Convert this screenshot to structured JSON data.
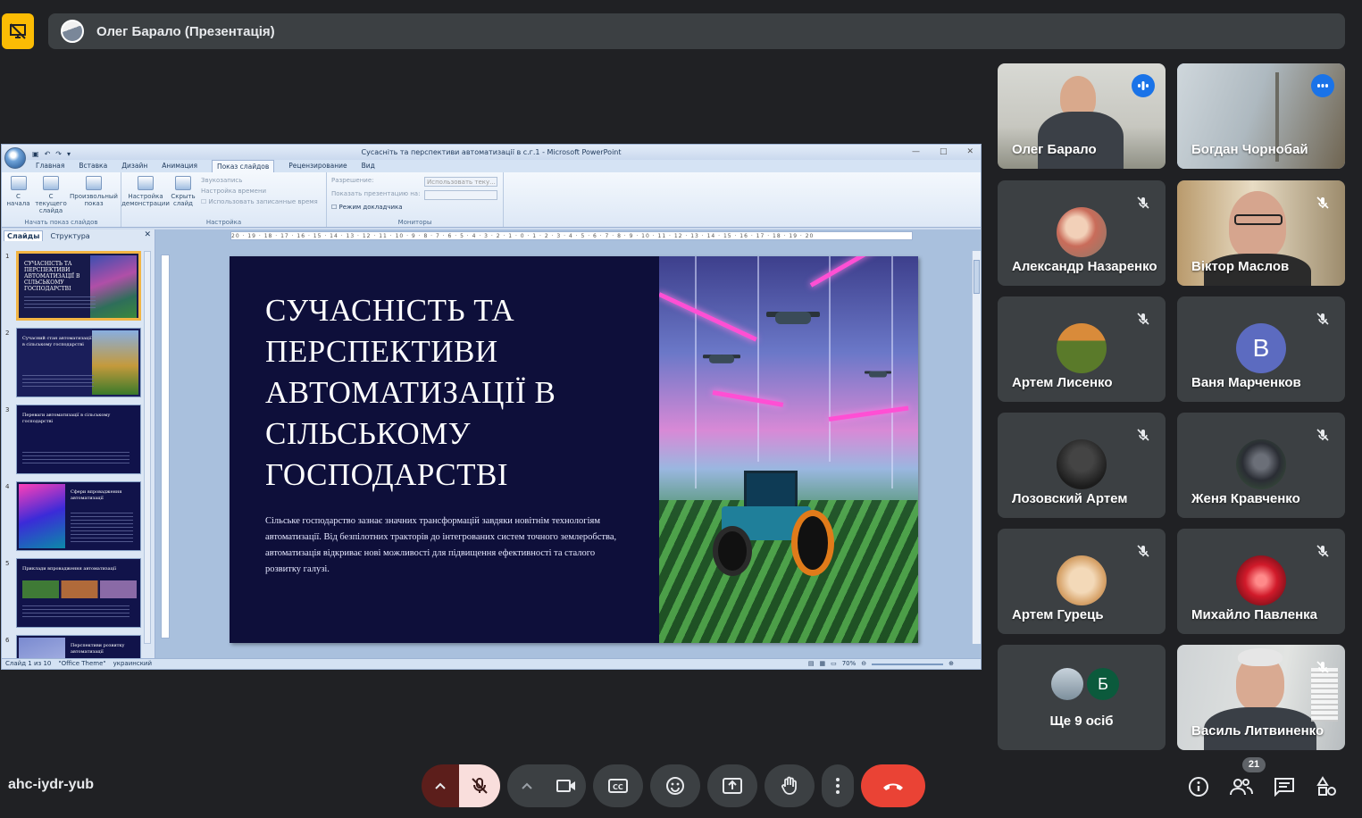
{
  "presenter_bar": {
    "name": "Олег Барало (Презентація)"
  },
  "powerpoint": {
    "window_title": "Сусасніть та перспективи автоматизації в с.г.1 - Microsoft PowerPoint",
    "ribbon_tabs": [
      "Главная",
      "Вставка",
      "Дизайн",
      "Анимация",
      "Показ слайдов",
      "Рецензирование",
      "Вид"
    ],
    "active_tab": "Показ слайдов",
    "groups": {
      "start": {
        "label": "Начать показ слайдов",
        "from_start": "С начала",
        "from_current": "С текущего слайда",
        "custom": "Произвольный показ"
      },
      "setup": {
        "label": "Настройка",
        "setup_show": "Настройка демонстрации",
        "hide_slide": "Скрыть слайд",
        "record_narration": "Звукозапись",
        "rehearse": "Настройка времени",
        "use_timings": "Использовать записанные время"
      },
      "monitors": {
        "label": "Мониторы",
        "resolution_label": "Разрешение:",
        "resolution_value": "Использовать теку...",
        "show_on_label": "Показать презентацию на:",
        "presenter_view": "Режим докладчика"
      }
    },
    "panel_tabs": {
      "slides": "Слайды",
      "outline": "Структура"
    },
    "thumbnails": [
      {
        "num": "1",
        "title": "СУЧАСНІСТЬ ТА ПЕРСПЕКТИВИ АВТОМАТИЗАЦІЇ В СІЛЬСЬКОМУ ГОСПОДАРСТВІ"
      },
      {
        "num": "2",
        "title": "Сучасний стан автоматизації в сільському господарстві"
      },
      {
        "num": "3",
        "title": "Переваги автоматизації в сільському господарстві"
      },
      {
        "num": "4",
        "title": "Сфери впровадження автоматизації"
      },
      {
        "num": "5",
        "title": "Приклади впровадження автоматизації"
      },
      {
        "num": "6",
        "title": "Перспективи розвитку автоматизації"
      }
    ],
    "ruler_text": "20 · 19 · 18 · 17 · 16 · 15 · 14 · 13 · 12 · 11 · 10 · 9 · 8 · 7 · 6 · 5 · 4 · 3 · 2 · 1 · 0 · 1 · 2 · 3 · 4 · 5 · 6 · 7 · 8 · 9 · 10 · 11 · 12 · 13 · 14 · 15 · 16 · 17 · 18 · 19 · 20",
    "slide": {
      "title": "СУЧАСНІСТЬ ТА ПЕРСПЕКТИВИ АВТОМАТИЗАЦІЇ В СІЛЬСЬКОМУ ГОСПОДАРСТВІ",
      "body": "Сільське господарство зазнає значних трансформацій завдяки новітнім технологіям автоматизації. Від безпілотних тракторів до інтегрованих систем точного землеробства, автоматизація відкриває нові можливості для підвищення ефективності та сталого розвитку галузі."
    },
    "status": {
      "slide_of": "Слайд 1 из 10",
      "theme": "\"Office Theme\"",
      "language": "украинский",
      "zoom": "70%"
    }
  },
  "participants": [
    {
      "name": "Олег Барало",
      "state": "speaking"
    },
    {
      "name": "Богдан Чорнобай",
      "state": "speaking"
    },
    {
      "name": "Александр Назаренко",
      "state": "muted"
    },
    {
      "name": "Віктор Маслов",
      "state": "muted"
    },
    {
      "name": "Артем Лисенко",
      "state": "muted"
    },
    {
      "name": "Ваня Марченков",
      "state": "muted",
      "initial": "В"
    },
    {
      "name": "Лозовский Артем",
      "state": "muted"
    },
    {
      "name": "Женя Кравченко",
      "state": "muted"
    },
    {
      "name": "Артем Гурець",
      "state": "muted"
    },
    {
      "name": "Михайло Павленка",
      "state": "muted"
    },
    {
      "name": "Василь Литвиненко",
      "state": "muted"
    }
  ],
  "more": {
    "label": "Ще 9 осіб",
    "initial": "Б"
  },
  "bottom_bar": {
    "meeting_code": "ahc-iydr-yub",
    "participants_count": "21"
  },
  "colors": {
    "background": "#202124",
    "tile": "#3c4043",
    "accent_blue": "#1a73e8",
    "end_call": "#ea4335",
    "badge_yellow": "#fbbc04"
  }
}
